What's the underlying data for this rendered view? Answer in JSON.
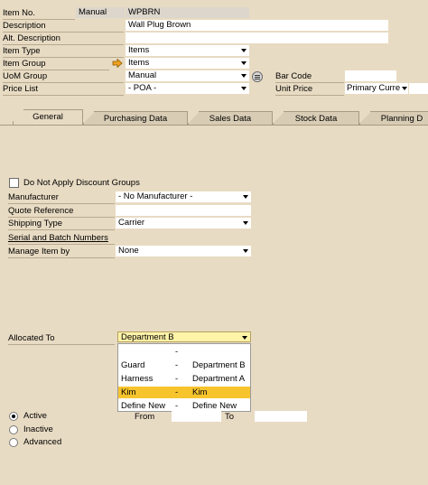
{
  "header": {
    "item_no": {
      "label": "Item No.",
      "series": "Manual",
      "value": "WPBRN"
    },
    "description": {
      "label": "Description",
      "value": "Wall Plug Brown"
    },
    "alt_description": {
      "label": "Alt. Description",
      "value": ""
    },
    "item_type": {
      "label": "Item Type",
      "value": "Items"
    },
    "item_group": {
      "label": "Item Group",
      "value": "Items"
    },
    "uom_group": {
      "label": "UoM Group",
      "value": "Manual"
    },
    "price_list": {
      "label": "Price List",
      "value": "- POA -"
    },
    "bar_code": {
      "label": "Bar Code",
      "value": ""
    },
    "unit_price": {
      "label": "Unit Price",
      "value": "",
      "currency": "Primary Curre"
    }
  },
  "tabs": [
    {
      "label": "General",
      "active": true
    },
    {
      "label": "Purchasing Data",
      "active": false
    },
    {
      "label": "Sales Data",
      "active": false
    },
    {
      "label": "Stock Data",
      "active": false
    },
    {
      "label": "Planning D",
      "active": false
    }
  ],
  "general": {
    "discount_groups": {
      "label": "Do Not Apply Discount Groups",
      "checked": false
    },
    "manufacturer": {
      "label": "Manufacturer",
      "value": "- No Manufacturer -"
    },
    "quote_reference": {
      "label": "Quote Reference",
      "value": ""
    },
    "shipping_type": {
      "label": "Shipping Type",
      "value": "Carrier"
    },
    "serial_batch_link": "Serial and Batch Numbers",
    "manage_item_by": {
      "label": "Manage Item by",
      "value": "None"
    },
    "allocated_to": {
      "label": "Allocated To",
      "value": "Department B"
    },
    "allocated_options": [
      {
        "code": "",
        "sep": "-",
        "name": "",
        "selected": false
      },
      {
        "code": "Guard",
        "sep": "-",
        "name": "Department B",
        "selected": false
      },
      {
        "code": "Harness",
        "sep": "-",
        "name": "Department A",
        "selected": false
      },
      {
        "code": "Kim",
        "sep": "-",
        "name": "Kim",
        "selected": true
      },
      {
        "code": "Define New",
        "sep": "-",
        "name": "Define New",
        "selected": false
      }
    ],
    "from_label": "From",
    "to_label": "To",
    "status": [
      {
        "label": "Active",
        "selected": true
      },
      {
        "label": "Inactive",
        "selected": false
      },
      {
        "label": "Advanced",
        "selected": false
      }
    ]
  },
  "colors": {
    "background": "#e8dbc3",
    "selection": "#f7c42e",
    "combo_highlight": "#fff3a8",
    "arrow": "#f0a020"
  }
}
